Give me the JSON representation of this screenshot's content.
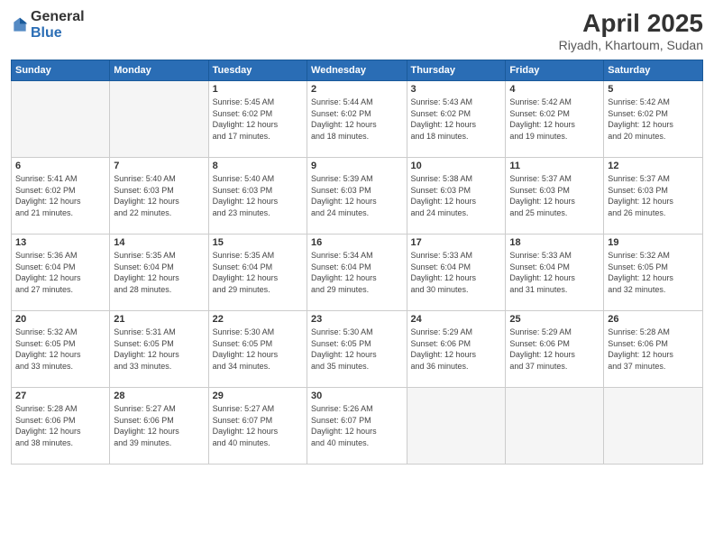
{
  "logo": {
    "general": "General",
    "blue": "Blue"
  },
  "title": "April 2025",
  "subtitle": "Riyadh, Khartoum, Sudan",
  "days_of_week": [
    "Sunday",
    "Monday",
    "Tuesday",
    "Wednesday",
    "Thursday",
    "Friday",
    "Saturday"
  ],
  "weeks": [
    [
      {
        "day": "",
        "empty": true
      },
      {
        "day": "",
        "empty": true
      },
      {
        "day": "1",
        "sunrise": "5:45 AM",
        "sunset": "6:02 PM",
        "daylight": "12 hours and 17 minutes."
      },
      {
        "day": "2",
        "sunrise": "5:44 AM",
        "sunset": "6:02 PM",
        "daylight": "12 hours and 18 minutes."
      },
      {
        "day": "3",
        "sunrise": "5:43 AM",
        "sunset": "6:02 PM",
        "daylight": "12 hours and 18 minutes."
      },
      {
        "day": "4",
        "sunrise": "5:42 AM",
        "sunset": "6:02 PM",
        "daylight": "12 hours and 19 minutes."
      },
      {
        "day": "5",
        "sunrise": "5:42 AM",
        "sunset": "6:02 PM",
        "daylight": "12 hours and 20 minutes."
      }
    ],
    [
      {
        "day": "6",
        "sunrise": "5:41 AM",
        "sunset": "6:02 PM",
        "daylight": "12 hours and 21 minutes."
      },
      {
        "day": "7",
        "sunrise": "5:40 AM",
        "sunset": "6:03 PM",
        "daylight": "12 hours and 22 minutes."
      },
      {
        "day": "8",
        "sunrise": "5:40 AM",
        "sunset": "6:03 PM",
        "daylight": "12 hours and 23 minutes."
      },
      {
        "day": "9",
        "sunrise": "5:39 AM",
        "sunset": "6:03 PM",
        "daylight": "12 hours and 24 minutes."
      },
      {
        "day": "10",
        "sunrise": "5:38 AM",
        "sunset": "6:03 PM",
        "daylight": "12 hours and 24 minutes."
      },
      {
        "day": "11",
        "sunrise": "5:37 AM",
        "sunset": "6:03 PM",
        "daylight": "12 hours and 25 minutes."
      },
      {
        "day": "12",
        "sunrise": "5:37 AM",
        "sunset": "6:03 PM",
        "daylight": "12 hours and 26 minutes."
      }
    ],
    [
      {
        "day": "13",
        "sunrise": "5:36 AM",
        "sunset": "6:04 PM",
        "daylight": "12 hours and 27 minutes."
      },
      {
        "day": "14",
        "sunrise": "5:35 AM",
        "sunset": "6:04 PM",
        "daylight": "12 hours and 28 minutes."
      },
      {
        "day": "15",
        "sunrise": "5:35 AM",
        "sunset": "6:04 PM",
        "daylight": "12 hours and 29 minutes."
      },
      {
        "day": "16",
        "sunrise": "5:34 AM",
        "sunset": "6:04 PM",
        "daylight": "12 hours and 29 minutes."
      },
      {
        "day": "17",
        "sunrise": "5:33 AM",
        "sunset": "6:04 PM",
        "daylight": "12 hours and 30 minutes."
      },
      {
        "day": "18",
        "sunrise": "5:33 AM",
        "sunset": "6:04 PM",
        "daylight": "12 hours and 31 minutes."
      },
      {
        "day": "19",
        "sunrise": "5:32 AM",
        "sunset": "6:05 PM",
        "daylight": "12 hours and 32 minutes."
      }
    ],
    [
      {
        "day": "20",
        "sunrise": "5:32 AM",
        "sunset": "6:05 PM",
        "daylight": "12 hours and 33 minutes."
      },
      {
        "day": "21",
        "sunrise": "5:31 AM",
        "sunset": "6:05 PM",
        "daylight": "12 hours and 33 minutes."
      },
      {
        "day": "22",
        "sunrise": "5:30 AM",
        "sunset": "6:05 PM",
        "daylight": "12 hours and 34 minutes."
      },
      {
        "day": "23",
        "sunrise": "5:30 AM",
        "sunset": "6:05 PM",
        "daylight": "12 hours and 35 minutes."
      },
      {
        "day": "24",
        "sunrise": "5:29 AM",
        "sunset": "6:06 PM",
        "daylight": "12 hours and 36 minutes."
      },
      {
        "day": "25",
        "sunrise": "5:29 AM",
        "sunset": "6:06 PM",
        "daylight": "12 hours and 37 minutes."
      },
      {
        "day": "26",
        "sunrise": "5:28 AM",
        "sunset": "6:06 PM",
        "daylight": "12 hours and 37 minutes."
      }
    ],
    [
      {
        "day": "27",
        "sunrise": "5:28 AM",
        "sunset": "6:06 PM",
        "daylight": "12 hours and 38 minutes."
      },
      {
        "day": "28",
        "sunrise": "5:27 AM",
        "sunset": "6:06 PM",
        "daylight": "12 hours and 39 minutes."
      },
      {
        "day": "29",
        "sunrise": "5:27 AM",
        "sunset": "6:07 PM",
        "daylight": "12 hours and 40 minutes."
      },
      {
        "day": "30",
        "sunrise": "5:26 AM",
        "sunset": "6:07 PM",
        "daylight": "12 hours and 40 minutes."
      },
      {
        "day": "",
        "empty": true
      },
      {
        "day": "",
        "empty": true
      },
      {
        "day": "",
        "empty": true
      }
    ]
  ],
  "labels": {
    "sunrise": "Sunrise:",
    "sunset": "Sunset:",
    "daylight": "Daylight:"
  }
}
